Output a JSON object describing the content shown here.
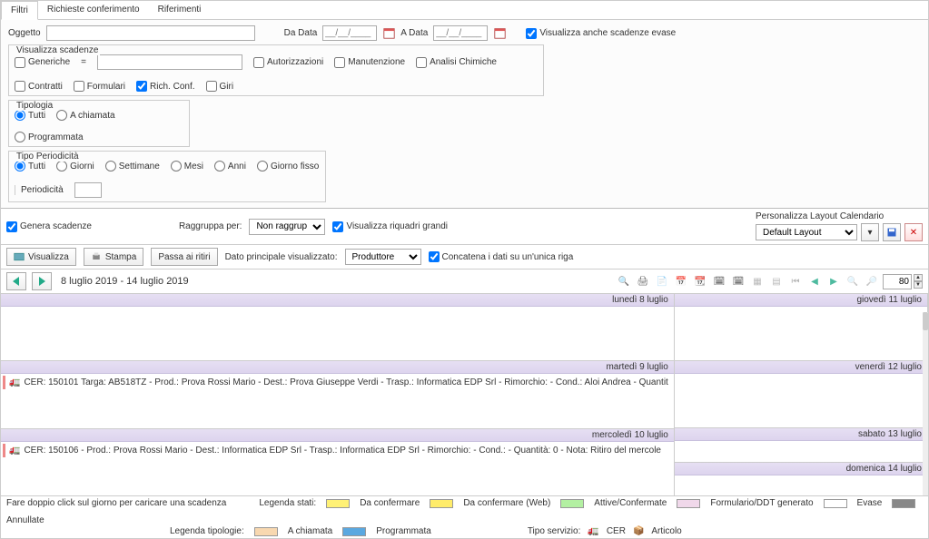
{
  "tabs": {
    "filtri": "Filtri",
    "richieste": "Richieste conferimento",
    "riferimenti": "Riferimenti"
  },
  "filters": {
    "oggetto_label": "Oggetto",
    "daData_label": "Da Data",
    "aData_label": "A Data",
    "date_placeholder": "__/__/____",
    "chk_evase": "Visualizza anche scadenze evase",
    "visualizza_scadenze": "Visualizza scadenze",
    "generiche": "Generiche",
    "eq": "=",
    "autorizzazioni": "Autorizzazioni",
    "manutenzione": "Manutenzione",
    "analisi": "Analisi Chimiche",
    "contratti": "Contratti",
    "formulari": "Formulari",
    "richconf": "Rich. Conf.",
    "giri": "Giri",
    "tipologia": "Tipologia",
    "tutti": "Tutti",
    "achiamata": "A chiamata",
    "programmata": "Programmata",
    "tipoPeriod": "Tipo Periodicità",
    "giorni": "Giorni",
    "settimane": "Settimane",
    "mesi": "Mesi",
    "anni": "Anni",
    "giornoFisso": "Giorno fisso",
    "periodicita": "Periodicità"
  },
  "mid": {
    "genera": "Genera scadenze",
    "raggruppa": "Raggruppa per:",
    "raggruppa_opt": "Non raggruppare",
    "dato": "Dato principale visualizzato:",
    "dato_opt": "Produttore",
    "grandi": "Visualizza riquadri grandi",
    "concatena": "Concatena i dati su un'unica riga",
    "visualizza_btn": "Visualizza",
    "stampa": "Stampa",
    "passa": "Passa ai ritiri",
    "layout_label": "Personalizza Layout Calendario",
    "layout_opt": "Default Layout"
  },
  "nav": {
    "range": "8 luglio 2019 - 14 luglio 2019",
    "zoom_val": "80"
  },
  "days": {
    "lun": "lunedì 8 luglio",
    "mar": "martedì 9 luglio",
    "mer": "mercoledì 10 luglio",
    "gio": "giovedì 11 luglio",
    "ven": "venerdì 12 luglio",
    "sab": "sabato 13 luglio",
    "dom": "domenica 14 luglio"
  },
  "events": {
    "mar": "CER: 150101 Targa: AB518TZ - Prod.: Prova Rossi Mario - Dest.: Prova Giuseppe Verdi - Trasp.: Informatica EDP Srl - Rimorchio:  - Cond.: Aloi Andrea - Quantit",
    "mer": "CER: 150106 - Prod.: Prova Rossi Mario - Dest.: Informatica EDP Srl - Trasp.: Informatica EDP Srl - Rimorchio:  - Cond.:  - Quantità: 0 - Nota: Ritiro del mercole"
  },
  "footer": {
    "hint": "Fare doppio click sul giorno per caricare una scadenza",
    "legenda_stati": "Legenda stati:",
    "da_conf": "Da confermare",
    "da_conf_web": "Da confermare (Web)",
    "attive": "Attive/Confermate",
    "fddt": "Formulario/DDT generato",
    "evase": "Evase",
    "annullate": "Annullate",
    "legenda_tip": "Legenda tipologie:",
    "achiamata": "A chiamata",
    "programmata": "Programmata",
    "tiposerv": "Tipo servizio:",
    "cer": "CER",
    "articolo": "Articolo"
  }
}
